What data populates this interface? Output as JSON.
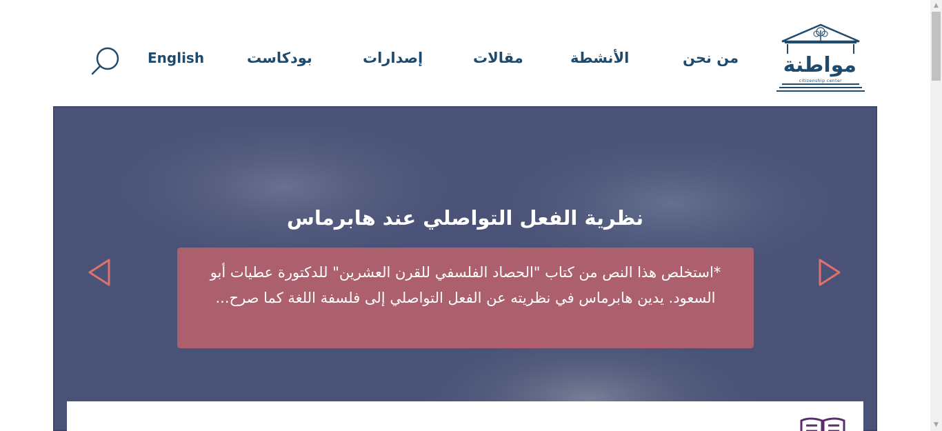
{
  "header": {
    "logo": {
      "wordmark": "مواطنة",
      "subtitle": "citizenship center"
    },
    "nav": {
      "about": "من نحن",
      "activities": "الأنشطة",
      "articles": "مقالات",
      "publications": "إصدارات",
      "podcast": "بودكاست",
      "language": "English"
    }
  },
  "hero": {
    "title": "نظرية الفعل التواصلي عند هابرماس",
    "excerpt": "*استخلص هذا النص من كتاب \"الحصاد الفلسفي للقرن العشرين\" للدكتورة عطيات أبو السعود. يدين هابرماس في نظريته عن الفعل التواصلي إلى فلسفة اللغة كما صرح...",
    "colors": {
      "overlay": "#4a5377",
      "excerpt_box": "#c9646a",
      "arrow": "#e0716f"
    }
  },
  "colors": {
    "brand": "#1e4a6e",
    "book_icon": "#5a2d6e"
  },
  "icons": {
    "search": "search-icon",
    "prev": "chevron-left-icon",
    "next": "chevron-right-icon",
    "book": "open-book-icon"
  }
}
